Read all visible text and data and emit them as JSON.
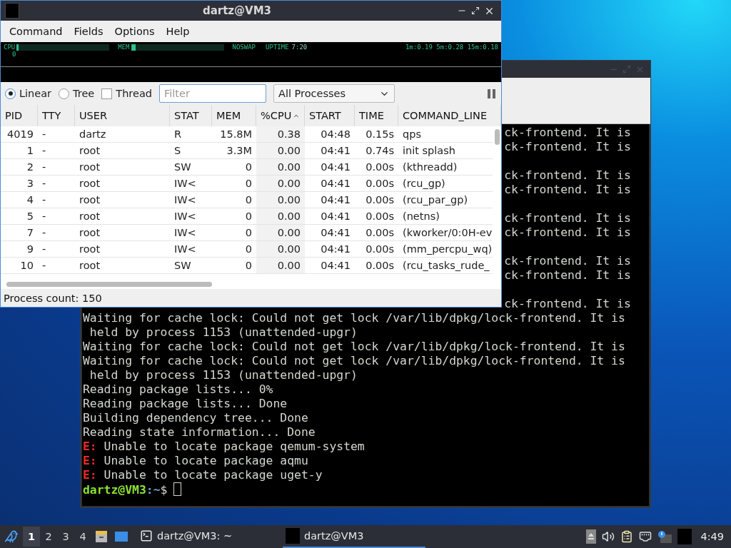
{
  "terminal_window": {
    "lines": [
      {
        "kind": "fragment",
        "text": "ck-frontend. It is"
      },
      {
        "kind": "fragment",
        "text": "ck-frontend. It is"
      },
      {
        "kind": "blank"
      },
      {
        "kind": "fragment",
        "text": "ck-frontend. It is"
      },
      {
        "kind": "fragment",
        "text": "ck-frontend. It is"
      },
      {
        "kind": "blank"
      },
      {
        "kind": "fragment",
        "text": "ck-frontend. It is"
      },
      {
        "kind": "fragment",
        "text": "ck-frontend. It is"
      },
      {
        "kind": "blank"
      },
      {
        "kind": "fragment",
        "text": "ck-frontend. It is"
      },
      {
        "kind": "fragment",
        "text": "ck-frontend. It is"
      },
      {
        "kind": "blank"
      },
      {
        "kind": "fragment",
        "text": "ck-frontend. It is"
      },
      {
        "kind": "line",
        "text": "Waiting for cache lock: Could not get lock /var/lib/dpkg/lock-frontend. It is"
      },
      {
        "kind": "line",
        "text": " held by process 1153 (unattended-upgr)"
      },
      {
        "kind": "line",
        "text": "Waiting for cache lock: Could not get lock /var/lib/dpkg/lock-frontend. It is"
      },
      {
        "kind": "line",
        "text": "Waiting for cache lock: Could not get lock /var/lib/dpkg/lock-frontend. It is"
      },
      {
        "kind": "line",
        "text": " held by process 1153 (unattended-upgr)"
      },
      {
        "kind": "line",
        "text": "Reading package lists... 0%"
      },
      {
        "kind": "line",
        "text": "Reading package lists... Done"
      },
      {
        "kind": "line",
        "text": "Building dependency tree... Done"
      },
      {
        "kind": "line",
        "text": "Reading state information... Done"
      },
      {
        "kind": "error",
        "prefix": "E:",
        "text": " Unable to locate package qemum-system"
      },
      {
        "kind": "error",
        "prefix": "E:",
        "text": " Unable to locate package aqmu"
      },
      {
        "kind": "error",
        "prefix": "E:",
        "text": " Unable to locate package uget-y"
      },
      {
        "kind": "prompt",
        "user_host": "dartz@VM3",
        "path": ":~",
        "symbol": "$"
      }
    ]
  },
  "qps_window": {
    "title": "dartz@VM3",
    "menu": [
      "Command",
      "Fields",
      "Options",
      "Help"
    ],
    "info": {
      "cpu_label": "CPU",
      "cpu_index": "0",
      "mem_label": "MEM",
      "swap": "NOSWAP",
      "uptime_label": "UPTIME",
      "uptime": "7:20",
      "load": "1m:0.19 5m:0.28 15m:0.18"
    },
    "view_modes": [
      {
        "label": "Linear",
        "selected": true
      },
      {
        "label": "Tree",
        "selected": false
      }
    ],
    "thread": {
      "label": "Thread",
      "checked": false
    },
    "filter": {
      "placeholder": "Filter"
    },
    "process_filter": "All Processes",
    "columns": [
      {
        "label": "PID",
        "kind": "number",
        "sorted": false
      },
      {
        "label": "TTY",
        "kind": "text",
        "sorted": false
      },
      {
        "label": "USER",
        "kind": "text",
        "sorted": false
      },
      {
        "label": "STAT",
        "kind": "text",
        "sorted": false
      },
      {
        "label": "MEM",
        "kind": "number",
        "sorted": false
      },
      {
        "label": "%CPU",
        "kind": "number",
        "sorted": true
      },
      {
        "label": "START",
        "kind": "number",
        "sorted": false
      },
      {
        "label": "TIME",
        "kind": "number",
        "sorted": false
      },
      {
        "label": "COMMAND_LINE",
        "kind": "text",
        "sorted": false
      }
    ],
    "rows": [
      [
        "4019",
        "-",
        "dartz",
        "R",
        "15.8M",
        "0.38",
        "04:48",
        "0.15s",
        "qps"
      ],
      [
        "1",
        "-",
        "root",
        "S",
        "3.3M",
        "0.00",
        "04:41",
        "0.74s",
        "init splash"
      ],
      [
        "2",
        "-",
        "root",
        "SW",
        "0",
        "0.00",
        "04:41",
        "0.00s",
        "(kthreadd)"
      ],
      [
        "3",
        "-",
        "root",
        "IW<",
        "0",
        "0.00",
        "04:41",
        "0.00s",
        "(rcu_gp)"
      ],
      [
        "4",
        "-",
        "root",
        "IW<",
        "0",
        "0.00",
        "04:41",
        "0.00s",
        "(rcu_par_gp)"
      ],
      [
        "5",
        "-",
        "root",
        "IW<",
        "0",
        "0.00",
        "04:41",
        "0.00s",
        "(netns)"
      ],
      [
        "7",
        "-",
        "root",
        "IW<",
        "0",
        "0.00",
        "04:41",
        "0.00s",
        "(kworker/0:0H-ev"
      ],
      [
        "9",
        "-",
        "root",
        "IW<",
        "0",
        "0.00",
        "04:41",
        "0.00s",
        "(mm_percpu_wq)"
      ],
      [
        "10",
        "-",
        "root",
        "SW",
        "0",
        "0.00",
        "04:41",
        "0.00s",
        "(rcu_tasks_rude_"
      ]
    ],
    "status": "Process count: 150"
  },
  "taskbar": {
    "workspaces": [
      {
        "label": "1",
        "selected": true
      },
      {
        "label": "2",
        "selected": false
      },
      {
        "label": "3",
        "selected": false
      },
      {
        "label": "4",
        "selected": false
      }
    ],
    "tasks": [
      {
        "kind": "terminal",
        "label": "dartz@VM3: ~",
        "selected": false
      },
      {
        "kind": "app",
        "label": "dartz@VM3",
        "selected": true
      }
    ],
    "clock": "4:49"
  }
}
